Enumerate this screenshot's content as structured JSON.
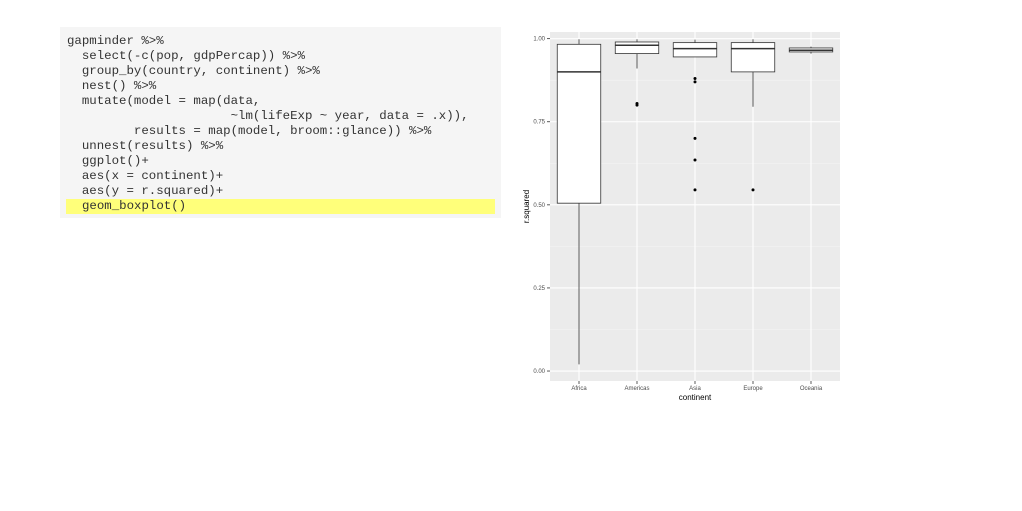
{
  "code": {
    "lines": [
      {
        "text": "gapminder %>%",
        "highlight": false
      },
      {
        "text": "  select(-c(pop, gdpPercap)) %>%",
        "highlight": false
      },
      {
        "text": "  group_by(country, continent) %>%",
        "highlight": false
      },
      {
        "text": "  nest() %>%",
        "highlight": false
      },
      {
        "text": "  mutate(model = map(data,",
        "highlight": false
      },
      {
        "text": "                      ~lm(lifeExp ~ year, data = .x)),",
        "highlight": false
      },
      {
        "text": "         results = map(model, broom::glance)) %>%",
        "highlight": false
      },
      {
        "text": "  unnest(results) %>%",
        "highlight": false
      },
      {
        "text": "  ggplot()+",
        "highlight": false
      },
      {
        "text": "  aes(x = continent)+",
        "highlight": false
      },
      {
        "text": "  aes(y = r.squared)+",
        "highlight": false
      },
      {
        "text": "geom_boxplot()",
        "highlight": true
      }
    ]
  },
  "chart_data": {
    "type": "boxplot",
    "xlabel": "continent",
    "ylabel": "r.squared",
    "ylim": [
      -0.03,
      1.02
    ],
    "yticks": [
      0.0,
      0.25,
      0.5,
      0.75,
      1.0
    ],
    "ytick_labels": [
      "0.00",
      "0.25",
      "0.50",
      "0.75",
      "1.00"
    ],
    "categories": [
      "Africa",
      "Americas",
      "Asia",
      "Europe",
      "Oceania"
    ],
    "boxes": [
      {
        "category": "Africa",
        "min": 0.02,
        "q1": 0.505,
        "median": 0.9,
        "q3": 0.983,
        "max": 0.998,
        "outliers": []
      },
      {
        "category": "Americas",
        "min": 0.91,
        "q1": 0.955,
        "median": 0.98,
        "q3": 0.99,
        "max": 0.998,
        "outliers": [
          0.8,
          0.805
        ]
      },
      {
        "category": "Asia",
        "min": 0.945,
        "q1": 0.945,
        "median": 0.97,
        "q3": 0.988,
        "max": 0.997,
        "outliers": [
          0.87,
          0.88,
          0.7,
          0.635,
          0.545
        ]
      },
      {
        "category": "Europe",
        "min": 0.795,
        "q1": 0.9,
        "median": 0.97,
        "q3": 0.988,
        "max": 0.998,
        "outliers": [
          0.545
        ]
      },
      {
        "category": "Oceania",
        "min": 0.955,
        "q1": 0.96,
        "median": 0.965,
        "q3": 0.972,
        "max": 0.976,
        "outliers": []
      }
    ],
    "grid": true,
    "colors": {
      "panel": "#ebebeb",
      "grid_major": "#ffffff",
      "grid_minor": "#f4f4f4",
      "box_fill": "#ffffff",
      "box_stroke": "#333333"
    }
  }
}
